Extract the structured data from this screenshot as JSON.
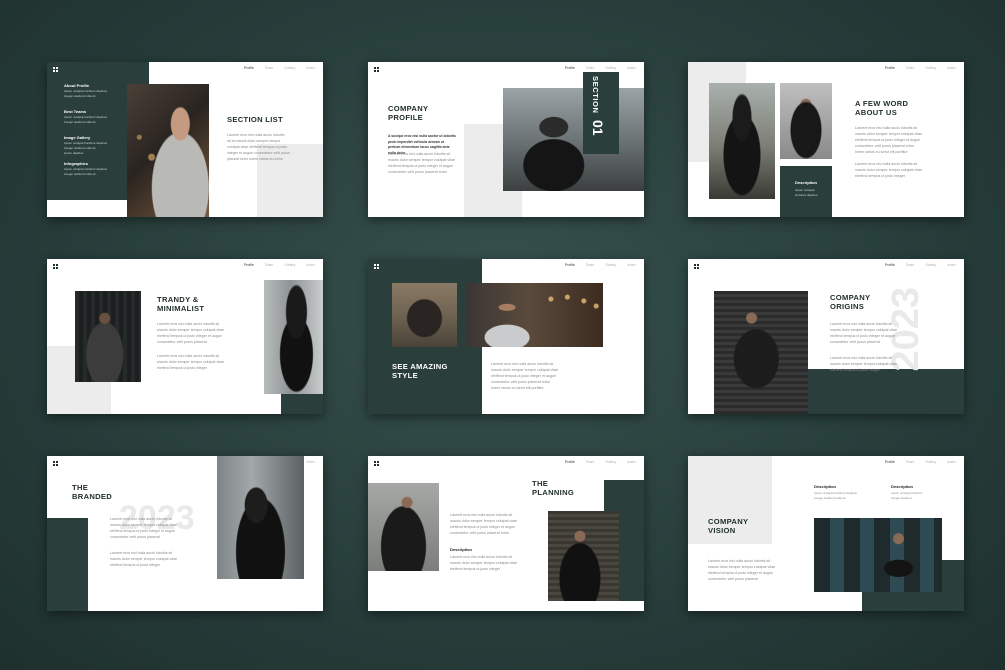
{
  "nav": [
    "Profile",
    "Team",
    "Gallery",
    "Index"
  ],
  "slides": {
    "s1": {
      "sidebar": [
        {
          "label": "About Profile",
          "text": "Ipsum volutpat tincidunt dapibus\ninteger eleifend nulla sit"
        },
        {
          "label": "Best Teams",
          "text": "Ipsum volutpat tincidunt dapibus\ninteger eleifend nulla sit"
        },
        {
          "label": "Image Gallery",
          "text": "Ipsum volutpat tincidunt dapibus\ninteger eleifend nulla sit\nipsum dapibus"
        },
        {
          "label": "Infographics",
          "text": "Ipsum volutpat tincidunt dapibus\ninteger eleifend nulla sit"
        }
      ],
      "title": "SECTION LIST",
      "body": "Laoreet eros nisi nulla aucto lobortis\nsit at mauris dolor semper tempor\nvolutpat vitae eleifend tempus ut justo\ninteger et augue consectetur velit purus\nplaceat tortor lorem varius eu tortor"
    },
    "s2": {
      "title": "COMPANY\nPROFILE",
      "lead": "A sociqut eros nisi nulla auctor ut lobortis\nproin imperdiet vehicula aenean ut\npretium elementum lacus sagittis ante\nnulla dolor",
      "body": "Laoreet eros nisi nulla aucto lobortis sit\nmauris dolor semper tempor volutpat vitae\neleifend tempus ut justo integer et augue\nconsectetur velit purus placerat tortor",
      "section": "SECTION",
      "num": "01"
    },
    "s3": {
      "title": "A FEW WORD\nABOUT US",
      "desc_label": "Description",
      "desc": "Ipsum volutpat\ntincidunt dapibus",
      "body1": "Laoreet eros nisi nulla aucto lobortis sit\nmauris dolor semper tempor volutpat vitae\neleifend tempus ut justo integer et augue\nconsectetur velit purus placerat tortor\nlorem varius eu tortor elit porttitor",
      "body2": "Laoreet eros nisi nulla aucto lobortis sit\nmauris dolor semper tempor volutpat vitae\neleifend tempus ut justo integer"
    },
    "s4": {
      "title": "TRANDY &\nMINIMALIST",
      "body1": "Laoreet eros nisi nulla aucto lobortis sit\nmauris dolor semper tempor volutpat vitae\neleifend tempus ut justo integer et augue\nconsectetur velit purus placerat",
      "body2": "Laoreet eros nisi nulla aucto lobortis sit\nmauris dolor semper tempor volutpat vitae\neleifend tempus ut justo integer"
    },
    "s5": {
      "title": "SEE AMAZING\nSTYLE",
      "body": "Laoreet eros nisi nulla aucto lobortis sit\nmauris dolor semper tempor volutpat vitae\neleifend tempus ut justo integer et augue\nconsectetur velit purus placerat tortor\nlorem varius eu tortor elit porttitor"
    },
    "s6": {
      "title": "COMPANY\nORIGINS",
      "year": "2023",
      "body1": "Laoreet eros nisi nulla aucto lobortis sit\nmauris dolor semper tempor volutpat vitae\neleifend tempus ut justo integer et augue\nconsectetur velit purus placerat",
      "body2": "Laoreet eros nisi nulla aucto lobortis sit\nmauris dolor semper tempor volutpat vitae\neleifend tempus ut justo integer"
    },
    "s7": {
      "title": "THE\nBRANDED",
      "year": "2023",
      "body1": "Laoreet eros nisi nulla aucto lobortis sit\nmauris dolor semper tempor volutpat vitae\neleifend tempus ut justo integer et augue\nconsectetur velit purus placerat",
      "body2": "Laoreet eros nisi nulla aucto lobortis sit\nmauris dolor semper tempor volutpat vitae\neleifend tempus ut justo integer"
    },
    "s8": {
      "title": "THE\nPLANNING",
      "body1": "Laoreet eros nisi nulla aucto lobortis sit\nmauris dolor semper tempor volutpat vitae\neleifend tempus ut justo integer et augue\nconsectetur velit purus placerat tortor",
      "desc_label": "Description",
      "body2": "Laoreet eros nisi nulla aucto lobortis sit\nmauris dolor semper tempor volutpat vitae\neleifend tempus ut justo integer"
    },
    "s9": {
      "title": "COMPANY\nVISION",
      "desc1_label": "Description",
      "desc1": "Ipsum volutpat tincidunt dapibus\ninteger eleifend nulla sit",
      "desc2_label": "Description",
      "desc2": "Ipsum volutpat tincidunt\ninteger eleifend",
      "body": "Laoreet eros nisi nulla aucto lobortis sit\nmauris dolor semper tempor volutpat vitae\neleifend tempus ut justo integer et augue\nconsectetur velit purus placerat"
    }
  },
  "colors": {
    "background": "#283f3c",
    "accent": "#2a3e3b",
    "panel": "#ececec"
  }
}
